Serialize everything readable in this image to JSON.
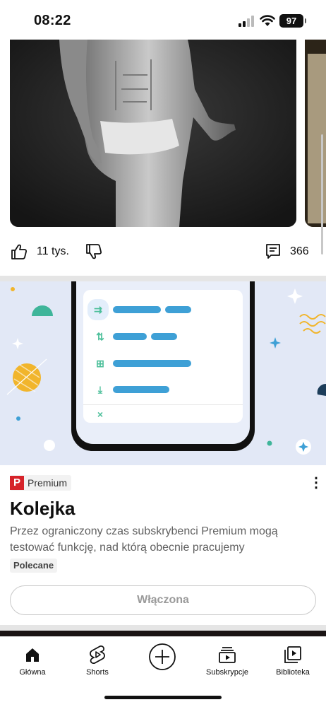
{
  "status_bar": {
    "time": "08:22",
    "battery": "97"
  },
  "post_actions": {
    "likes": "11 tys.",
    "comments": "366"
  },
  "premium_card": {
    "badge_label": "Premium",
    "badge_letter": "P",
    "title": "Kolejka",
    "description": "Przez ograniczony czas subskrybenci Premium mogą testować funkcję, nad którą obecnie pracujemy",
    "tag": "Polecane",
    "button_label": "Włączona"
  },
  "nav": {
    "items": [
      {
        "label": "Główna",
        "icon": "home-icon"
      },
      {
        "label": "Shorts",
        "icon": "shorts-icon"
      },
      {
        "label": "",
        "icon": "create-icon"
      },
      {
        "label": "Subskrypcje",
        "icon": "subscriptions-icon"
      },
      {
        "label": "Biblioteka",
        "icon": "library-icon"
      }
    ]
  },
  "colors": {
    "accent_red": "#d6232a",
    "banner_bg": "#e2e8f6",
    "queue_pill": "#3ea0d6",
    "queue_icon": "#4cbf9a"
  }
}
